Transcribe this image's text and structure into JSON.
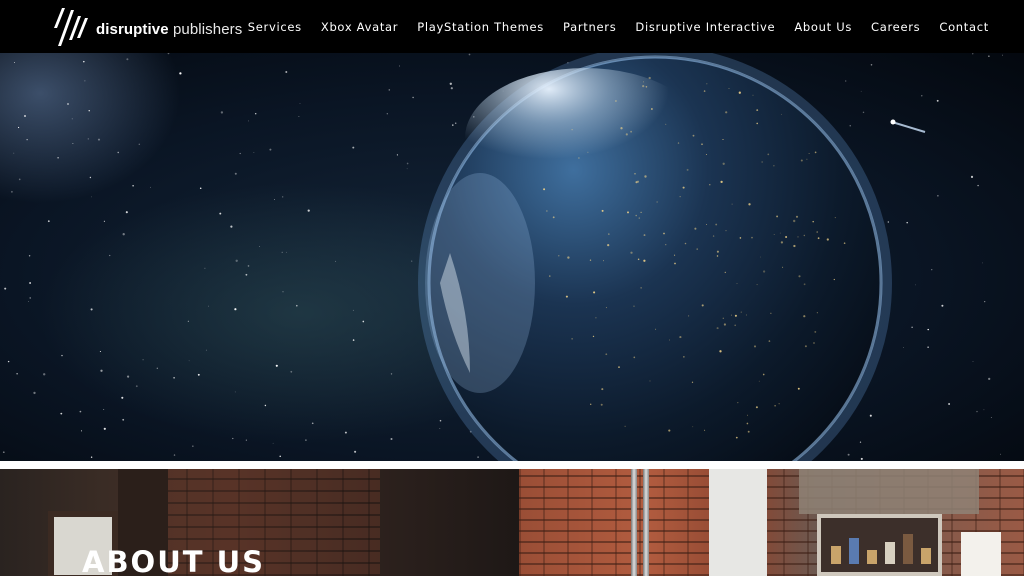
{
  "header": {
    "logo_bold": "disruptive",
    "logo_light": "publishers",
    "nav": [
      {
        "label": "Services"
      },
      {
        "label": "Xbox Avatar"
      },
      {
        "label": "PlayStation Themes"
      },
      {
        "label": "Partners"
      },
      {
        "label": "Disruptive Interactive"
      },
      {
        "label": "About Us"
      },
      {
        "label": "Careers"
      },
      {
        "label": "Contact"
      }
    ]
  },
  "about": {
    "title": "ABOUT US"
  },
  "colors": {
    "header_bg": "#000000",
    "text": "#ffffff",
    "space_bg": "#060c16",
    "planet_glow": "#8fc4ff"
  }
}
